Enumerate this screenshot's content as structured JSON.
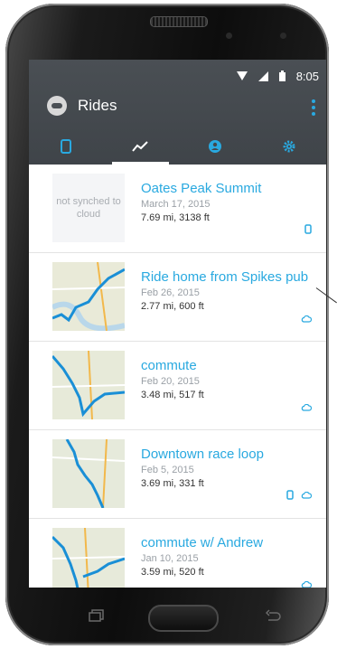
{
  "status_bar": {
    "time": "8:05"
  },
  "app_bar": {
    "title": "Rides"
  },
  "tabs": [
    {
      "icon": "phone-icon",
      "active": false
    },
    {
      "icon": "trend-icon",
      "active": true
    },
    {
      "icon": "person-icon",
      "active": false
    },
    {
      "icon": "gear-icon",
      "active": false
    }
  ],
  "rides": [
    {
      "name": "Oates Peak Summit",
      "date": "March 17, 2015",
      "stats": "7.69 mi, 3138 ft",
      "thumb_text": "not synched to cloud",
      "on_phone": true,
      "on_cloud": false
    },
    {
      "name": "Ride home from Spikes pub",
      "date": "Feb 26, 2015",
      "stats": "2.77 mi, 600 ft",
      "on_phone": false,
      "on_cloud": true
    },
    {
      "name": "commute",
      "date": "Feb 20, 2015",
      "stats": "3.48 mi, 517 ft",
      "on_phone": false,
      "on_cloud": true
    },
    {
      "name": "Downtown race loop",
      "date": "Feb 5, 2015",
      "stats": "3.69 mi, 331 ft",
      "on_phone": true,
      "on_cloud": true
    },
    {
      "name": "commute w/ Andrew",
      "date": "Jan 10, 2015",
      "stats": "3.59 mi, 520 ft",
      "on_phone": false,
      "on_cloud": true
    }
  ],
  "colors": {
    "accent": "#29a9e0",
    "app_bar": "#43484d",
    "date_text": "#9aa0a6"
  }
}
